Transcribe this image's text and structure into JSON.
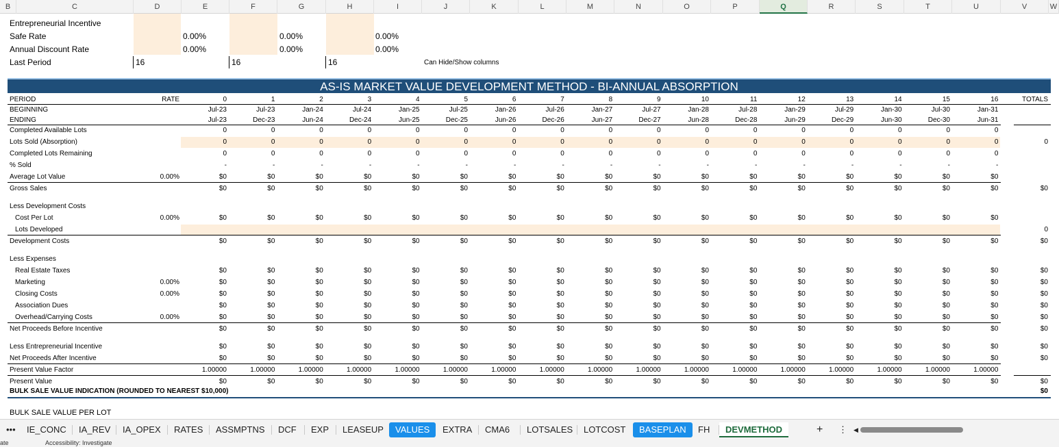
{
  "columns": [
    "B",
    "C",
    "D",
    "E",
    "F",
    "G",
    "H",
    "I",
    "J",
    "K",
    "L",
    "M",
    "N",
    "O",
    "P",
    "Q",
    "R",
    "S",
    "T",
    "U",
    "V",
    "W"
  ],
  "selected_column": "Q",
  "top": {
    "row0_label": "Entrepreneurial Incentive",
    "safe_rate_label": "Safe Rate",
    "annual_discount_label": "Annual Discount Rate",
    "last_period_label": "Last Period",
    "rate_values": [
      "0.00%",
      "0.00%",
      "0.00%"
    ],
    "discount_values": [
      "0.00%",
      "0.00%",
      "0.00%"
    ],
    "last_period_values": [
      "16",
      "16",
      "16"
    ],
    "hide_show_note": "Can Hide/Show columns"
  },
  "banner": "AS-IS MARKET VALUE DEVELOPMENT METHOD - BI-ANNUAL ABSORPTION",
  "header": {
    "period_label": "PERIOD",
    "rate_label": "RATE",
    "totals_label": "TOTALS",
    "beginning_label": "BEGINNING",
    "ending_label": "ENDING",
    "periods": [
      "0",
      "1",
      "2",
      "3",
      "4",
      "5",
      "6",
      "7",
      "8",
      "9",
      "10",
      "11",
      "12",
      "13",
      "14",
      "15",
      "16"
    ],
    "beginning": [
      "Jul-23",
      "Jul-23",
      "Jan-24",
      "Jul-24",
      "Jan-25",
      "Jul-25",
      "Jan-26",
      "Jul-26",
      "Jan-27",
      "Jul-27",
      "Jan-28",
      "Jul-28",
      "Jan-29",
      "Jul-29",
      "Jan-30",
      "Jul-30",
      "Jan-31"
    ],
    "ending": [
      "Jul-23",
      "Dec-23",
      "Jun-24",
      "Dec-24",
      "Jun-25",
      "Dec-25",
      "Jun-26",
      "Dec-26",
      "Jun-27",
      "Dec-27",
      "Jun-28",
      "Dec-28",
      "Jun-29",
      "Dec-29",
      "Jun-30",
      "Dec-30",
      "Jun-31"
    ]
  },
  "rows": [
    {
      "label": "Completed Available Lots",
      "rate": "",
      "value": "0",
      "total": ""
    },
    {
      "label": "Lots Sold (Absorption)",
      "rate": "",
      "value": "0",
      "total": "0"
    },
    {
      "label": "Completed Lots Remaining",
      "rate": "",
      "value": "0",
      "total": ""
    },
    {
      "label": "% Sold",
      "rate": "",
      "value": "-",
      "total": ""
    },
    {
      "label": "Average Lot Value",
      "rate": "0.00%",
      "value": "$0",
      "total": ""
    },
    {
      "label": "Gross Sales",
      "rate": "",
      "value": "$0",
      "total": "$0"
    },
    {
      "label": "Less Development Costs",
      "rate": "",
      "value": "",
      "total": ""
    },
    {
      "label": "Cost Per Lot",
      "rate": "0.00%",
      "value": "$0",
      "total": ""
    },
    {
      "label": "Lots Developed",
      "rate": "",
      "value": "",
      "total": "0"
    },
    {
      "label": "Development Costs",
      "rate": "",
      "value": "$0",
      "total": "$0"
    },
    {
      "label": "Less Expenses",
      "rate": "",
      "value": "",
      "total": ""
    },
    {
      "label": "Real Estate Taxes",
      "rate": "",
      "value": "$0",
      "total": "$0"
    },
    {
      "label": "Marketing",
      "rate": "0.00%",
      "value": "$0",
      "total": "$0"
    },
    {
      "label": "Closing Costs",
      "rate": "0.00%",
      "value": "$0",
      "total": "$0"
    },
    {
      "label": "Association Dues",
      "rate": "",
      "value": "$0",
      "total": "$0"
    },
    {
      "label": "Overhead/Carrying Costs",
      "rate": "0.00%",
      "value": "$0",
      "total": "$0"
    },
    {
      "label": "Net Proceeds Before Incentive",
      "rate": "",
      "value": "$0",
      "total": "$0"
    },
    {
      "label": "Less Entrepreneurial Incentive",
      "rate": "",
      "value": "$0",
      "total": "$0"
    },
    {
      "label": "Net Proceeds After Incentive",
      "rate": "",
      "value": "$0",
      "total": "$0"
    },
    {
      "label": "Present Value Factor",
      "rate": "",
      "value": "1.00000",
      "total": ""
    },
    {
      "label": "Present Value",
      "rate": "",
      "value": "$0",
      "total": "$0"
    }
  ],
  "bulk_label": "BULK SALE VALUE INDICATION (ROUNDED TO NEAREST $10,000)",
  "bulk_value": "$0",
  "bulk_per_lot_label": "BULK SALE VALUE PER LOT",
  "tabs": [
    {
      "label": "IE_CONC",
      "style": "normal"
    },
    {
      "label": "IA_REV",
      "style": "normal"
    },
    {
      "label": "IA_OPEX",
      "style": "normal"
    },
    {
      "label": "RATES",
      "style": "normal"
    },
    {
      "label": "ASSMPTNS",
      "style": "normal"
    },
    {
      "label": "DCF",
      "style": "normal"
    },
    {
      "label": "EXP",
      "style": "normal"
    },
    {
      "label": "LEASEUP",
      "style": "normal"
    },
    {
      "label": "VALUES",
      "style": "blue"
    },
    {
      "label": "EXTRA",
      "style": "normal"
    },
    {
      "label": "CMA6",
      "style": "normal"
    },
    {
      "label": "LOTSALES",
      "style": "normal"
    },
    {
      "label": "LOTCOST",
      "style": "normal"
    },
    {
      "label": "BASEPLAN",
      "style": "blue"
    },
    {
      "label": "FH",
      "style": "normal"
    },
    {
      "label": "DEVMETHOD",
      "style": "active"
    }
  ],
  "tab_controls": {
    "more": "•••",
    "add": "+",
    "options": "⋮",
    "scroll_left": "◀"
  },
  "status": {
    "left": "ate",
    "accessibility": "Accessibility: Investigate"
  }
}
